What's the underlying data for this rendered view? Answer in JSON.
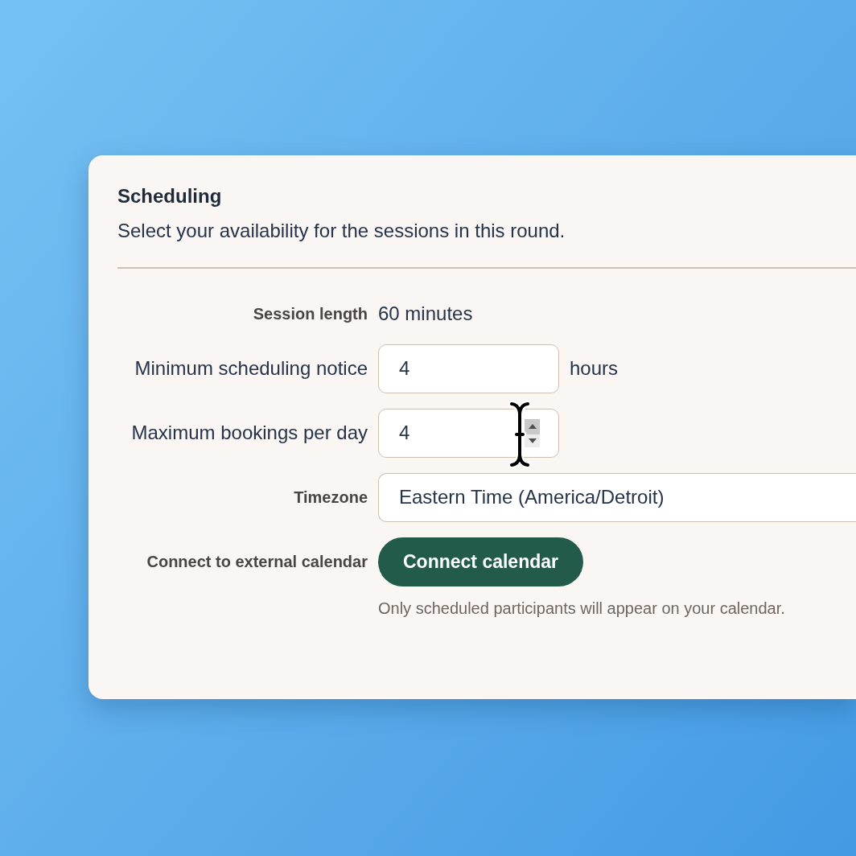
{
  "section": {
    "title": "Scheduling",
    "description": "Select your availability for the sessions in this round."
  },
  "fields": [
    {
      "kind": "text",
      "label": "Session length",
      "value": "60 minutes"
    },
    {
      "kind": "number",
      "label": "Minimum scheduling notice",
      "value": "4",
      "unit": "hours",
      "hovered": false
    },
    {
      "kind": "number",
      "label": "Maximum bookings per day",
      "value": "4",
      "hovered": true
    },
    {
      "kind": "select",
      "label": "Timezone",
      "value": "Eastern Time (America/Detroit)"
    },
    {
      "kind": "button",
      "label": "Connect to external calendar",
      "button_label": "Connect calendar",
      "help": "Only scheduled participants will appear on your calendar."
    }
  ]
}
